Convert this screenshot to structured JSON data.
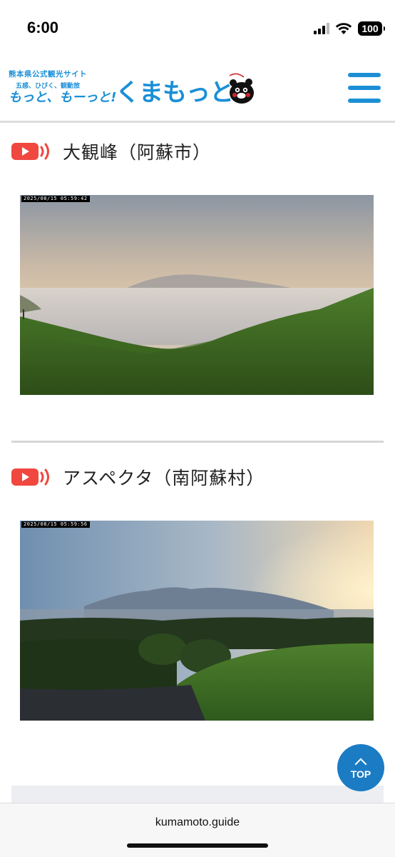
{
  "status_bar": {
    "time": "6:00",
    "battery": "100",
    "icons": [
      "signal-icon",
      "wifi-icon",
      "battery-icon"
    ]
  },
  "header": {
    "logo_line1": "熊本県公式観光サイト",
    "logo_line2": "五感、ひびく、観動旅",
    "logo_tagline": "もっと、もーっと!",
    "logo_brand": "くまもっと。",
    "menu_icon": "hamburger-menu-icon",
    "brand_color": "#1b8fd6"
  },
  "cameras": [
    {
      "title": "大観峰（阿蘇市）",
      "timestamp": "2025/08/15 05:59:42",
      "icon": "live-camera-icon"
    },
    {
      "title": "アスペクタ（南阿蘇村）",
      "timestamp": "2025/08/15 05:59:56",
      "icon": "live-camera-icon"
    }
  ],
  "top_button": {
    "label": "TOP",
    "icon": "chevron-up-icon",
    "color": "#1b7cc4"
  },
  "browser": {
    "url": "kumamoto.guide"
  },
  "accent_colors": {
    "camera_icon": "#f0473f"
  }
}
